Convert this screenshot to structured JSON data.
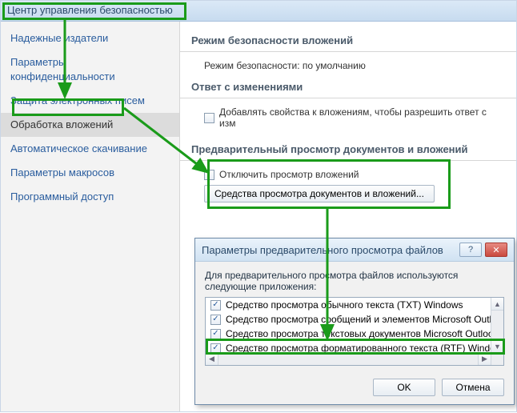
{
  "window_title": "Центр управления безопасностью",
  "sidebar": {
    "items": [
      {
        "label": "Надежные издатели"
      },
      {
        "label": "Параметры конфиденциальности"
      },
      {
        "label": "Защита электронных писем"
      },
      {
        "label": "Обработка вложений",
        "selected": true
      },
      {
        "label": "Автоматическое скачивание"
      },
      {
        "label": "Параметры макросов"
      },
      {
        "label": "Программный доступ"
      }
    ]
  },
  "sections": {
    "attachment_security": {
      "title": "Режим безопасности вложений",
      "line": "Режим безопасности: по умолчанию"
    },
    "reply_changes": {
      "title": "Ответ с изменениями",
      "checkbox_label": "Добавлять свойства к вложениям, чтобы разрешить ответ с изм"
    },
    "preview": {
      "title": "Предварительный просмотр документов и вложений",
      "disable_label": "Отключить просмотр вложений",
      "button_label": "Средства просмотра документов и вложений..."
    }
  },
  "dialog": {
    "title": "Параметры предварительного просмотра файлов",
    "instruction": "Для предварительного просмотра файлов используются следующие приложения:",
    "items": [
      "Средство просмотра обычного текста (TXT) Windows",
      "Средство просмотра сообщений и элементов Microsoft Outlo",
      "Средство просмотра текстовых документов Microsoft Outlook",
      "Средство просмотра форматированного текста (RTF) Window"
    ],
    "ok": "OK",
    "cancel": "Отмена"
  }
}
